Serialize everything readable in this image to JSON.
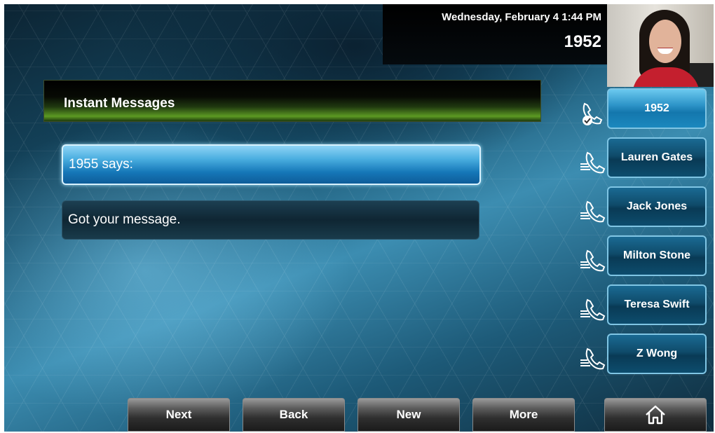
{
  "status": {
    "datetime": "Wednesday, February 4  1:44 PM",
    "line_number": "1952"
  },
  "header": {
    "title": "Instant Messages"
  },
  "messages": [
    {
      "text": "1955 says:"
    },
    {
      "text": "Got your message."
    }
  ],
  "line_keys": [
    {
      "label": "1952",
      "icon": "phone-registered-icon"
    },
    {
      "label": "Lauren Gates",
      "icon": "phone-speed-dial-icon"
    },
    {
      "label": "Jack Jones",
      "icon": "phone-speed-dial-icon"
    },
    {
      "label": "Milton Stone",
      "icon": "phone-speed-dial-icon"
    },
    {
      "label": "Teresa Swift",
      "icon": "phone-speed-dial-icon"
    },
    {
      "label": "Z Wong",
      "icon": "phone-speed-dial-icon"
    }
  ],
  "softkeys": [
    {
      "label": "Next"
    },
    {
      "label": "Back"
    },
    {
      "label": "New"
    },
    {
      "label": "More"
    }
  ],
  "home_icon": "home-icon"
}
